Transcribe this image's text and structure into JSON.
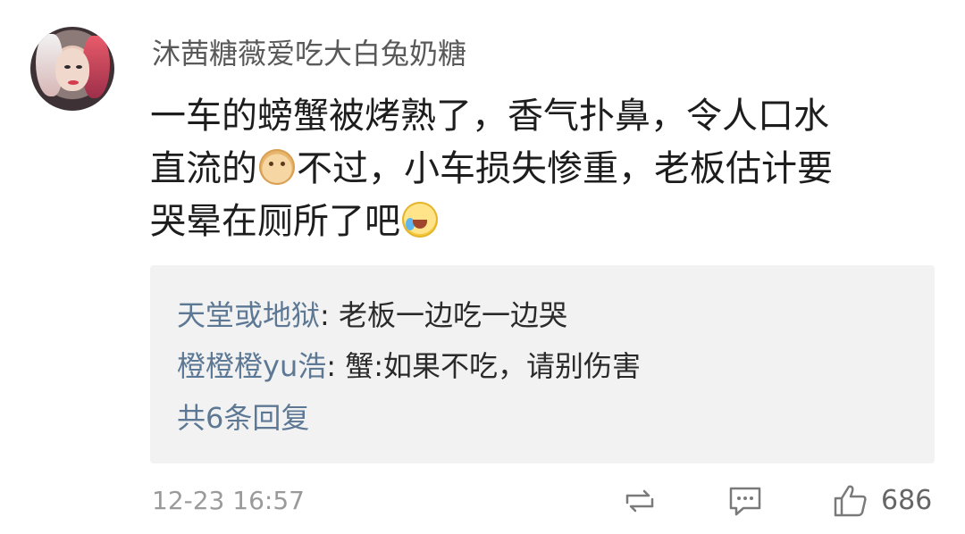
{
  "comment": {
    "username": "沐茜糖薇爱吃大白兔奶糖",
    "body_part1": "一车的螃蟹被烤熟了，香气扑鼻，令人口水",
    "body_part2": "直流的",
    "body_part3": "不过，小车损失惨重，老板估计要",
    "body_part4": "哭晕在厕所了吧",
    "emoji_1": "doge-icon",
    "emoji_2": "laugh-cry-icon"
  },
  "replies": [
    {
      "author": "天堂或地狱",
      "text": ": 老板一边吃一边哭"
    },
    {
      "author": "橙橙橙yu浩",
      "text": ": 蟹:如果不吃，请别伤害"
    }
  ],
  "more_replies_label": "共6条回复",
  "footer": {
    "timestamp": "12-23 16:57",
    "like_count": "686",
    "repost_icon": "repost-icon",
    "comment_icon": "comment-icon",
    "like_icon": "thumbs-up-icon"
  },
  "colors": {
    "text_main": "#1d1d1d",
    "username": "#595959",
    "reply_author": "#5d7894",
    "reply_bg": "#f2f2f2",
    "muted": "#9a9a9a"
  }
}
